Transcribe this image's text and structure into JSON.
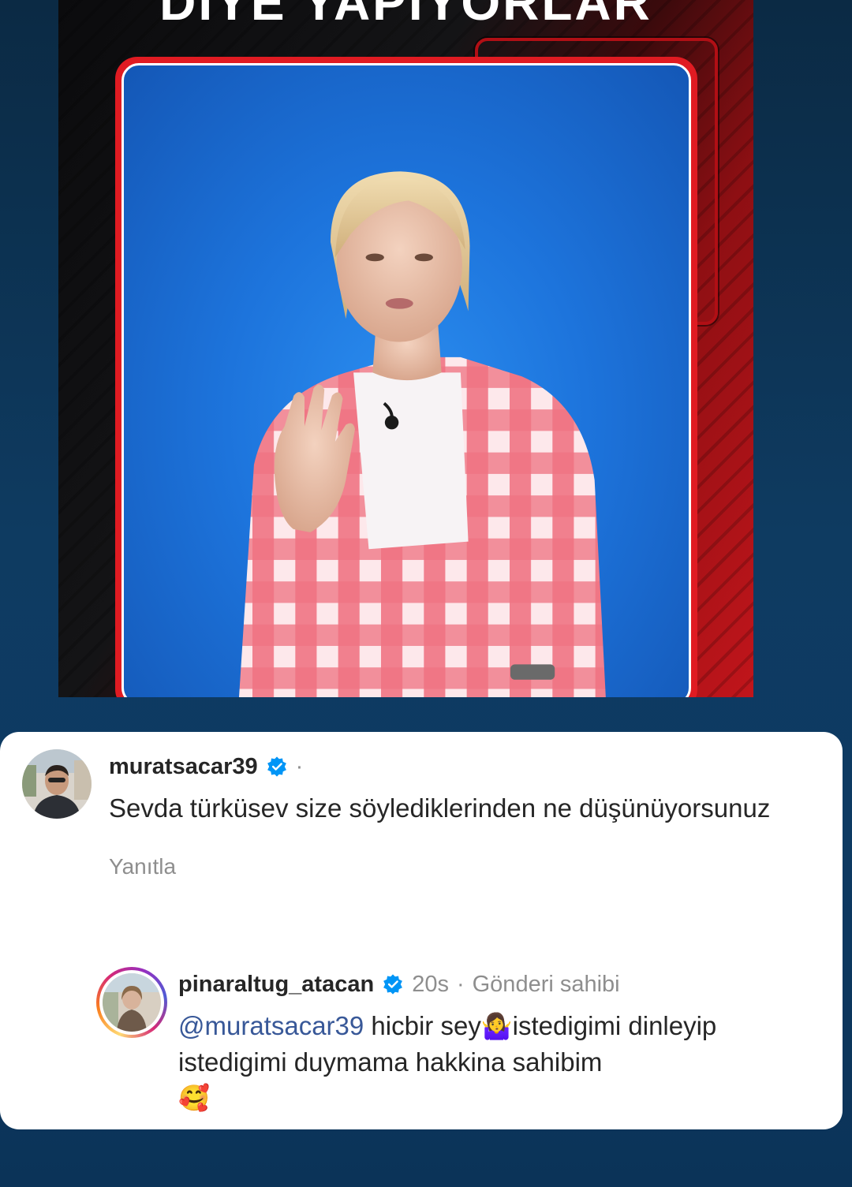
{
  "media": {
    "headline": "DİYE YAPIYORLAR"
  },
  "comments": [
    {
      "username": "muratsacar39",
      "verified": true,
      "meta": "·",
      "text": "Sevda türküsev size söylediklerinden ne düşünüyorsunuz",
      "reply_label": "Yanıtla"
    },
    {
      "username": "pinaraltug_atacan",
      "verified": true,
      "time": "20s",
      "separator": "·",
      "owner_label": "Gönderi sahibi",
      "mention": "@muratsacar39",
      "text_part1": " hicbir sey",
      "emoji_1": "🤷‍♀️",
      "text_part2": "istedigimi dinleyip istedigimi duymama hakkina sahibim",
      "emoji_2": "🥰"
    }
  ],
  "icons": {
    "verified": "verified-badge-icon",
    "emoji_1": "woman-shrugging-emoji",
    "emoji_2": "smiling-face-with-hearts-emoji"
  },
  "colors": {
    "verified_blue": "#0095f6",
    "mention": "#385898",
    "muted": "#8e8e8e",
    "text": "#262626"
  }
}
